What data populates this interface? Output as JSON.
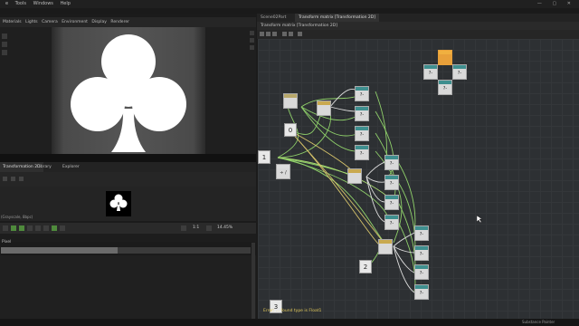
{
  "menubar": {
    "items": [
      "e",
      "Tools",
      "Windows",
      "Help"
    ],
    "controls": "— ▢ ✕"
  },
  "viewport": {
    "tabs": [
      "Materials",
      "Lights",
      "Camera",
      "Environment",
      "Display",
      "Renderer"
    ]
  },
  "left_panel": {
    "tabs": [
      "Transformation 2D",
      "Library",
      "Explorer"
    ],
    "preview_label": "(Grayscale, 8bpc)",
    "zoom_ratio": "1:1",
    "zoom_percent": "14.45%",
    "props_title": "Pixel"
  },
  "graph": {
    "tabs": [
      "Scene02Part",
      "Transform matrix [Transformation 2D]"
    ],
    "title": "Transform matrix [Transformation 2D]",
    "status": "Error: ... found type is Float1",
    "number_nodes": [
      "0",
      "1",
      "2",
      "3"
    ],
    "node_labels": {
      "op": "?-",
      "div": "÷ /"
    }
  },
  "colors": {
    "accent": "#3f8f8f",
    "wire_green": "#8fd06a",
    "wire_yellow": "#d6c36a",
    "selected_node": "#e8a03a"
  },
  "footer": "Substance Painter ©SecOS.stan"
}
